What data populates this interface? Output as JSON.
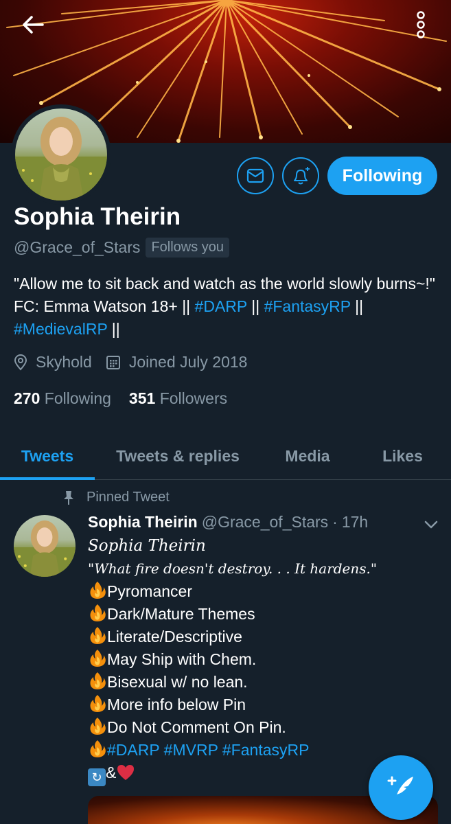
{
  "header": {
    "back_icon": "arrow-left-icon",
    "more_icon": "more-vertical-icon"
  },
  "profile": {
    "name": "Sophia Theirin",
    "handle": "@Grace_of_Stars",
    "follows_you": "Follows you",
    "follow_button": "Following",
    "bio_parts": {
      "line1": "\"Allow me to sit back and watch as the world slowly burns~!\"  FC: Emma Watson 18+ || ",
      "tag1": "#DARP",
      "sep1": " || ",
      "tag2": "#FantasyRP",
      "sep2": " || ",
      "tag3": "#MedievalRP",
      "sep3": " ||"
    },
    "location": "Skyhold",
    "joined": "Joined July 2018",
    "following_count": "270",
    "following_label": "Following",
    "followers_count": "351",
    "followers_label": "Followers"
  },
  "tabs": [
    {
      "label": "Tweets",
      "active": true
    },
    {
      "label": "Tweets & replies",
      "active": false
    },
    {
      "label": "Media",
      "active": false
    },
    {
      "label": "Likes",
      "active": false
    }
  ],
  "pinned_tweet": {
    "pinned_label": "Pinned Tweet",
    "author_name": "Sophia Theirin",
    "author_handle": "@Grace_of_Stars",
    "dot": "·",
    "time": "17h",
    "title": "Sophia Theirin",
    "quote": "\"What fire doesn't destroy. . . It hardens.\"",
    "items": [
      "Pyromancer",
      "Dark/Mature Themes",
      "Literate/Descriptive",
      "May Ship with Chem.",
      "Bisexual w/ no lean.",
      "More info below Pin",
      "Do Not Comment On Pin."
    ],
    "hashtags": [
      "#DARP",
      "#MVRP",
      "#FantasyRP"
    ],
    "amp": "&"
  },
  "colors": {
    "background": "#15202b",
    "accent": "#1da1f2",
    "muted": "#8899a6"
  }
}
